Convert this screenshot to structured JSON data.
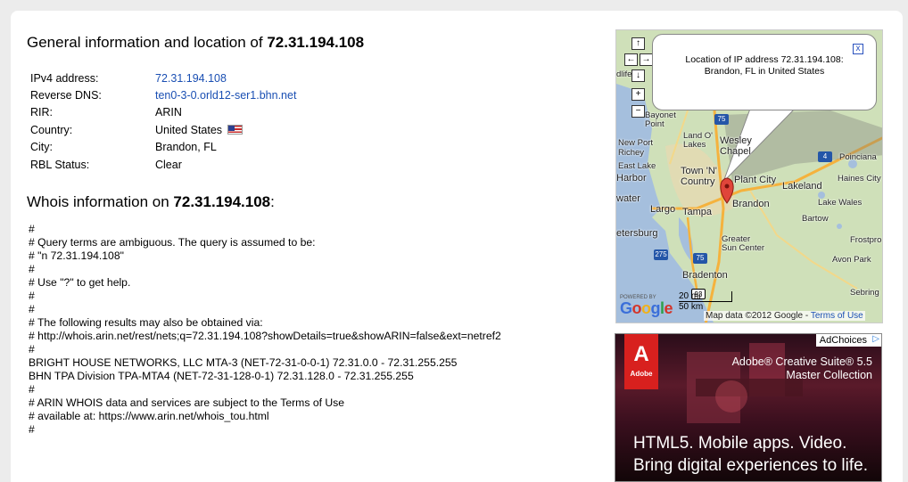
{
  "general": {
    "title_prefix": "General information and location of",
    "ip": "72.31.194.108",
    "rows": [
      {
        "label": "IPv4 address:",
        "value": "72.31.194.108",
        "link": true
      },
      {
        "label": "Reverse DNS:",
        "value": "ten0-3-0.orld12-ser1.bhn.net",
        "link": true
      },
      {
        "label": "RIR:",
        "value": "ARIN",
        "link": false
      },
      {
        "label": "Country:",
        "value": "United States",
        "link": false,
        "flag": "us-flag-icon"
      },
      {
        "label": "City:",
        "value": "Brandon, FL",
        "link": false
      },
      {
        "label": "RBL Status:",
        "value": "Clear",
        "link": false
      }
    ]
  },
  "whois": {
    "title_prefix": "Whois information on",
    "ip": "72.31.194.108",
    "title_suffix": ":",
    "lines": [
      "#",
      "# Query terms are ambiguous. The query is assumed to be:",
      "# \"n 72.31.194.108\"",
      "#",
      "# Use \"?\" to get help.",
      "#",
      "#",
      "# The following results may also be obtained via:",
      "# http://whois.arin.net/rest/nets;q=72.31.194.108?showDetails=true&showARIN=false&ext=netref2",
      "#",
      "BRIGHT HOUSE NETWORKS, LLC MTA-3 (NET-72-31-0-0-1) 72.31.0.0 - 72.31.255.255",
      "BHN TPA Division TPA-MTA4 (NET-72-31-128-0-1) 72.31.128.0 - 72.31.255.255",
      "#",
      "# ARIN WHOIS data and services are subject to the Terms of Use",
      "# available at: https://www.arin.net/whois_tou.html",
      "#"
    ]
  },
  "map": {
    "bubble_line1": "Location of IP address 72.31.194.108:",
    "bubble_line2": "Brandon, FL in United States",
    "close": "x",
    "nav_up": "↑",
    "nav_left": "←",
    "nav_right": "→",
    "nav_down": "↓",
    "zoom_in": "+",
    "zoom_out": "−",
    "places": [
      {
        "name": "Bayonet Point",
        "big": false
      },
      {
        "name": "Land O' Lakes",
        "big": false
      },
      {
        "name": "Wesley Chapel",
        "big": true
      },
      {
        "name": "New Port Richey",
        "big": false
      },
      {
        "name": "East Lake",
        "big": false
      },
      {
        "name": "Harbor",
        "big": false
      },
      {
        "name": "Town 'N' Country",
        "big": true
      },
      {
        "name": "Plant City",
        "big": true
      },
      {
        "name": "Lakeland",
        "big": true
      },
      {
        "name": "Haines City",
        "big": false
      },
      {
        "name": "Poinciana",
        "big": false
      },
      {
        "name": "water",
        "big": true
      },
      {
        "name": "Largo",
        "big": true
      },
      {
        "name": "Tampa",
        "big": true
      },
      {
        "name": "Brandon",
        "big": true
      },
      {
        "name": "Lake Wales",
        "big": false
      },
      {
        "name": "Bartow",
        "big": false
      },
      {
        "name": "etersburg",
        "big": true
      },
      {
        "name": "Greater Sun Center",
        "big": false
      },
      {
        "name": "Frostpro",
        "big": false
      },
      {
        "name": "Avon Park",
        "big": false
      },
      {
        "name": "Bradenton",
        "big": true
      },
      {
        "name": "Sebring",
        "big": false
      },
      {
        "name": "dlife",
        "big": false
      }
    ],
    "shields": [
      "75",
      "4",
      "275",
      "75",
      "93"
    ],
    "powered": "POWERED BY",
    "google": "Google",
    "scale_top": "20 mi",
    "scale_bottom": "50 km",
    "map_data": "Map data ©2012 Google",
    "terms": "Terms of Use",
    "colors": {
      "land": "#cfe0b9",
      "water": "#a5bfdd",
      "highway": "#f5b23d"
    }
  },
  "ad": {
    "adchoices": "AdChoices",
    "logo_letter": "A",
    "logo_text": "Adobe",
    "product_line1": "Adobe® Creative Suite® 5.5",
    "product_line2": "Master Collection",
    "tagline1": "HTML5. Mobile apps. Video.",
    "tagline2": "Bring digital experiences to life."
  }
}
